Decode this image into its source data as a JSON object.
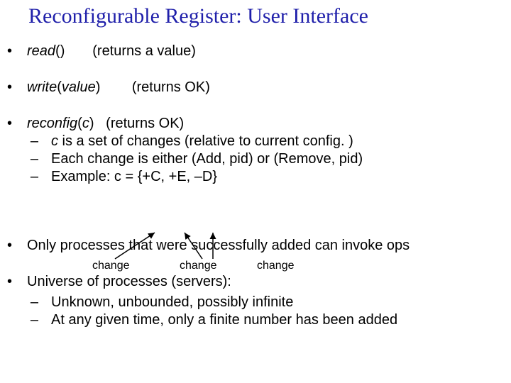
{
  "title": "Reconfigurable Register: User Interface",
  "bullets": {
    "b1": {
      "op": "read",
      "parens": "()",
      "ret": "(returns a value)"
    },
    "b2": {
      "op": "write",
      "paren_open": "(",
      "arg": "value",
      "paren_close": ")",
      "ret": "(returns OK)"
    },
    "b3": {
      "op": "reconfig",
      "paren_open": "(",
      "arg": "c",
      "paren_close": ")",
      "ret": "(returns OK)",
      "subs": {
        "s1a": "c",
        "s1b": " is a set of changes (relative to current config. )",
        "s2": "Each change is either (Add, pid) or (Remove, pid)",
        "s3": "Example: c = {+C, +E, –D}"
      }
    },
    "b4": "Only processes that were successfully added can invoke ops",
    "b5": {
      "text": "Universe of processes (servers):",
      "subs": {
        "s1": "Unknown, unbounded, possibly infinite",
        "s2": "At any given time, only a finite number has been added"
      }
    }
  },
  "labels": {
    "change1": "change",
    "change2": "change",
    "change3": "change"
  },
  "glyphs": {
    "bullet": "•",
    "dash": "–"
  }
}
